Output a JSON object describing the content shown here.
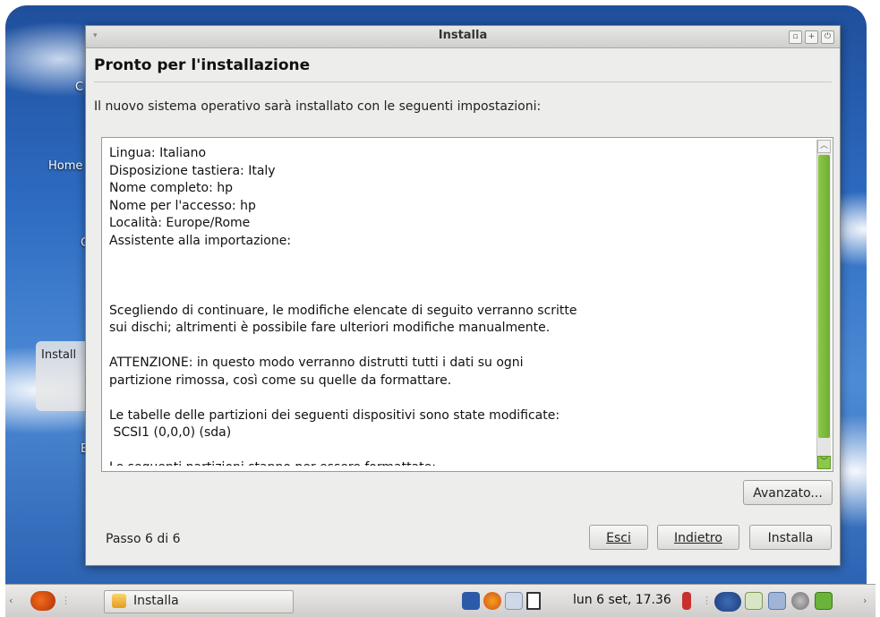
{
  "desktop": {
    "icons": [
      "C",
      "Home",
      "C",
      "Install",
      "E"
    ]
  },
  "window": {
    "title": "Installa",
    "heading": "Pronto per l'installazione",
    "intro": "Il nuovo sistema operativo sarà installato con le seguenti impostazioni:",
    "summary_lines": [
      "Lingua: Italiano",
      "Disposizione tastiera: Italy",
      "Nome completo: hp",
      "Nome per l'accesso: hp",
      "Località: Europe/Rome",
      "Assistente alla importazione:",
      "",
      "",
      "",
      "Scegliendo di continuare, le modifiche elencate di seguito verranno scritte",
      "sui dischi; altrimenti è possibile fare ulteriori modifiche manualmente.",
      "",
      "ATTENZIONE: in questo modo verranno distrutti tutti i dati su ogni",
      "partizione rimossa, così come su quelle da formattare.",
      "",
      "Le tabelle delle partizioni dei seguenti dispositivi sono state modificate:",
      " SCSI1 (0,0,0) (sda)",
      "",
      "Le seguenti partizioni stanno per essere formattate:"
    ],
    "advanced_label": "Avanzato...",
    "step_label": "Passo 6 di 6",
    "quit_label": "Esci",
    "back_label": "Indietro",
    "install_label": "Installa",
    "scroll_position": 0.0
  },
  "taskbar": {
    "task_label": "Installa",
    "clock": "lun  6 set, 17.36"
  },
  "colors": {
    "scroll_thumb": "#7ab83b",
    "desktop_sky": "#2e6cc2"
  }
}
